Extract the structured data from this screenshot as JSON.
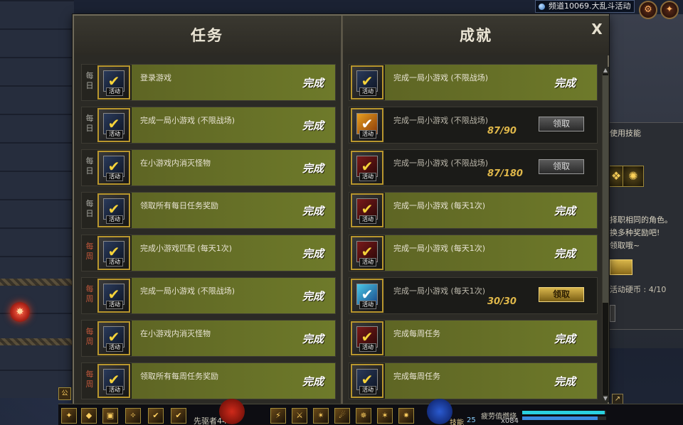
{
  "channel": {
    "label": "频道10069.大乱斗活动"
  },
  "dialog": {
    "left_title": "任务",
    "right_title": "成就",
    "close_label": "X"
  },
  "side_panel": {
    "title_fragment": "使用技能",
    "text_line1": "择职相同的角色。",
    "text_line2": "换多种奖励吧!",
    "text_line3": "领取哦~",
    "coin_label": "活动硬币 : 4/10"
  },
  "event_tag": "活动",
  "tasks": [
    {
      "freq": "每\n日",
      "freq_type": "daily",
      "title": "登录游戏",
      "status": "完成"
    },
    {
      "freq": "每\n日",
      "freq_type": "daily",
      "title": "完成一局小游戏 (不限战场)",
      "status": "完成"
    },
    {
      "freq": "每\n日",
      "freq_type": "daily",
      "title": "在小游戏内消灭怪物",
      "status": "完成"
    },
    {
      "freq": "每\n日",
      "freq_type": "daily",
      "title": "领取所有每日任务奖励",
      "status": "完成"
    },
    {
      "freq": "每\n周",
      "freq_type": "weekly",
      "title": "完成小游戏匹配 (每天1次)",
      "status": "完成"
    },
    {
      "freq": "每\n周",
      "freq_type": "weekly",
      "title": "完成一局小游戏 (不限战场)",
      "status": "完成"
    },
    {
      "freq": "每\n周",
      "freq_type": "weekly",
      "title": "在小游戏内消灭怪物",
      "status": "完成"
    },
    {
      "freq": "每\n周",
      "freq_type": "weekly",
      "title": "领取所有每周任务奖励",
      "status": "完成"
    }
  ],
  "achievements": [
    {
      "title": "完成一局小游戏 (不限战场)",
      "state": "done",
      "status": "完成",
      "icon_style": ""
    },
    {
      "title": "完成一局小游戏 (不限战场)",
      "state": "claim",
      "progress": "87/90",
      "button": "领取",
      "button_active": false,
      "icon_style": "gold"
    },
    {
      "title": "完成一局小游戏 (不限战场)",
      "state": "claim",
      "progress": "87/180",
      "button": "领取",
      "button_active": false,
      "icon_style": "red"
    },
    {
      "title": "完成一局小游戏 (每天1次)",
      "state": "done",
      "status": "完成",
      "icon_style": "red"
    },
    {
      "title": "完成一局小游戏 (每天1次)",
      "state": "done",
      "status": "完成",
      "icon_style": "red"
    },
    {
      "title": "完成一局小游戏 (每天1次)",
      "state": "claim",
      "progress": "30/30",
      "button": "领取",
      "button_active": true,
      "icon_style": "cyan"
    },
    {
      "title": "完成每周任务",
      "state": "done",
      "status": "完成",
      "icon_style": "red"
    },
    {
      "title": "完成每周任务",
      "state": "done",
      "status": "完成",
      "icon_style": ""
    }
  ],
  "hud": {
    "character": "先驱者44",
    "skill_label": "技能",
    "skill_value": "25",
    "fatigue_label": "疲劳值燃烧",
    "coin_value": "x084",
    "fatigue_fill": 0.98,
    "mp_fill": 0.9
  }
}
